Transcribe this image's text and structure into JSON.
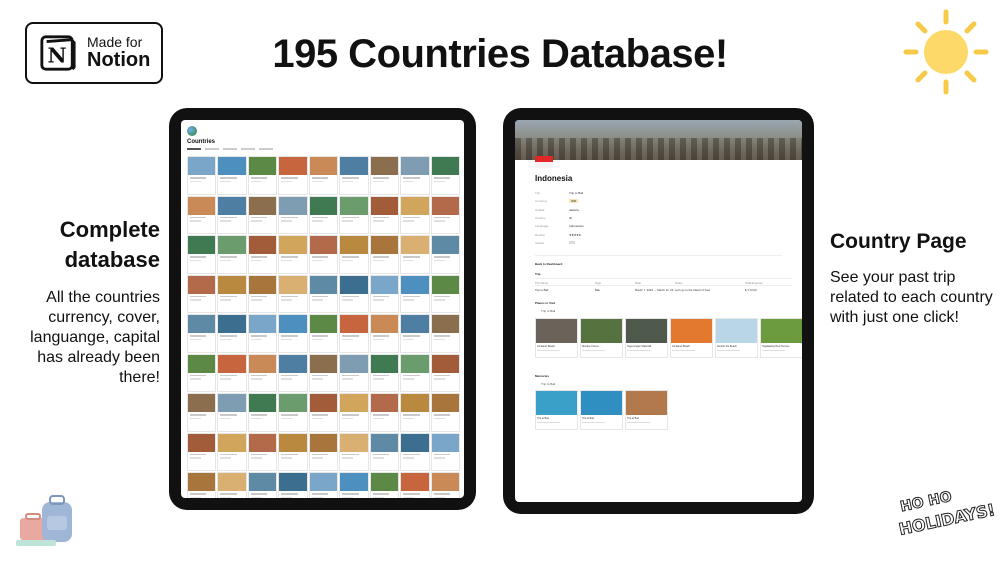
{
  "badge": {
    "line1": "Made for",
    "line2": "Notion"
  },
  "title": "195 Countries Database!",
  "left_panel": {
    "heading_line1": "Complete",
    "heading_line2": "database",
    "body": "All the countries currency, cover, languange, capital has already been there!"
  },
  "right_panel": {
    "heading": "Country Page",
    "body": "See your past trip related to each country with just one click!"
  },
  "left_screen": {
    "db_title": "Countries",
    "card_photo_colors": [
      "#7aa6c9",
      "#b9893f",
      "#3f7a52",
      "#c7653e",
      "#5e8aa6",
      "#d1a55b",
      "#8b6e4e",
      "#4d8fbf",
      "#a8753c",
      "#6b9c6e",
      "#c98a57",
      "#3c6e8f",
      "#b36a4a",
      "#7e9db3",
      "#5c8a46",
      "#d9b071",
      "#a35c3a",
      "#4f7ea3"
    ]
  },
  "right_screen": {
    "country_title": "Indonesia",
    "properties": [
      {
        "key": "Trip",
        "value": "Trip to Bali",
        "style": "text"
      },
      {
        "key": "Currency",
        "value": "IDR",
        "style": "pill"
      },
      {
        "key": "Capital",
        "value": "Jakarta",
        "style": "text"
      },
      {
        "key": "Country",
        "value": "ID",
        "style": "text"
      },
      {
        "key": "Language",
        "value": "Indonesian",
        "style": "text"
      },
      {
        "key": "Review",
        "value": "★★★★★",
        "style": "stars"
      },
      {
        "key": "Visited",
        "value": "",
        "style": "box"
      }
    ],
    "back_link": "Back to Dashboard",
    "trip_section": "Trip",
    "trip_table_headers": [
      "Trip Name",
      "Tags",
      "Date",
      "Notes",
      "Total Expense"
    ],
    "trip_row": [
      "Trip to Bali",
      "Bali",
      "March 7, 2023 → March 11, 23",
      "Let's go to the Island of God",
      "$ 1,70.00"
    ],
    "places_section": "Places to Visit",
    "places_group": "Trip to Bali",
    "places": [
      {
        "name": "Jimbaran Beach",
        "color": "#6b6259"
      },
      {
        "name": "Monkey Forest",
        "color": "#56723f"
      },
      {
        "name": "Tegenungan Waterfall",
        "color": "#4f5a4c"
      },
      {
        "name": "Jimbaran Beach",
        "color": "#e2792e"
      },
      {
        "name": "Double Six Beach",
        "color": "#b8d6e6"
      },
      {
        "name": "Tegallalang Rice Terrace",
        "color": "#6c9a3f"
      }
    ],
    "memories_section": "Memories",
    "memories_group": "Trip to Bali",
    "memories": [
      {
        "name": "Trip to Bali",
        "color": "#3aa0c8"
      },
      {
        "name": "Trip to Bali",
        "color": "#2f8fc0"
      },
      {
        "name": "Trip to Bali",
        "color": "#b27a4c"
      }
    ]
  },
  "decor": {
    "holidays_line1": "HO HO",
    "holidays_line2": "HOLIDAYS!"
  }
}
